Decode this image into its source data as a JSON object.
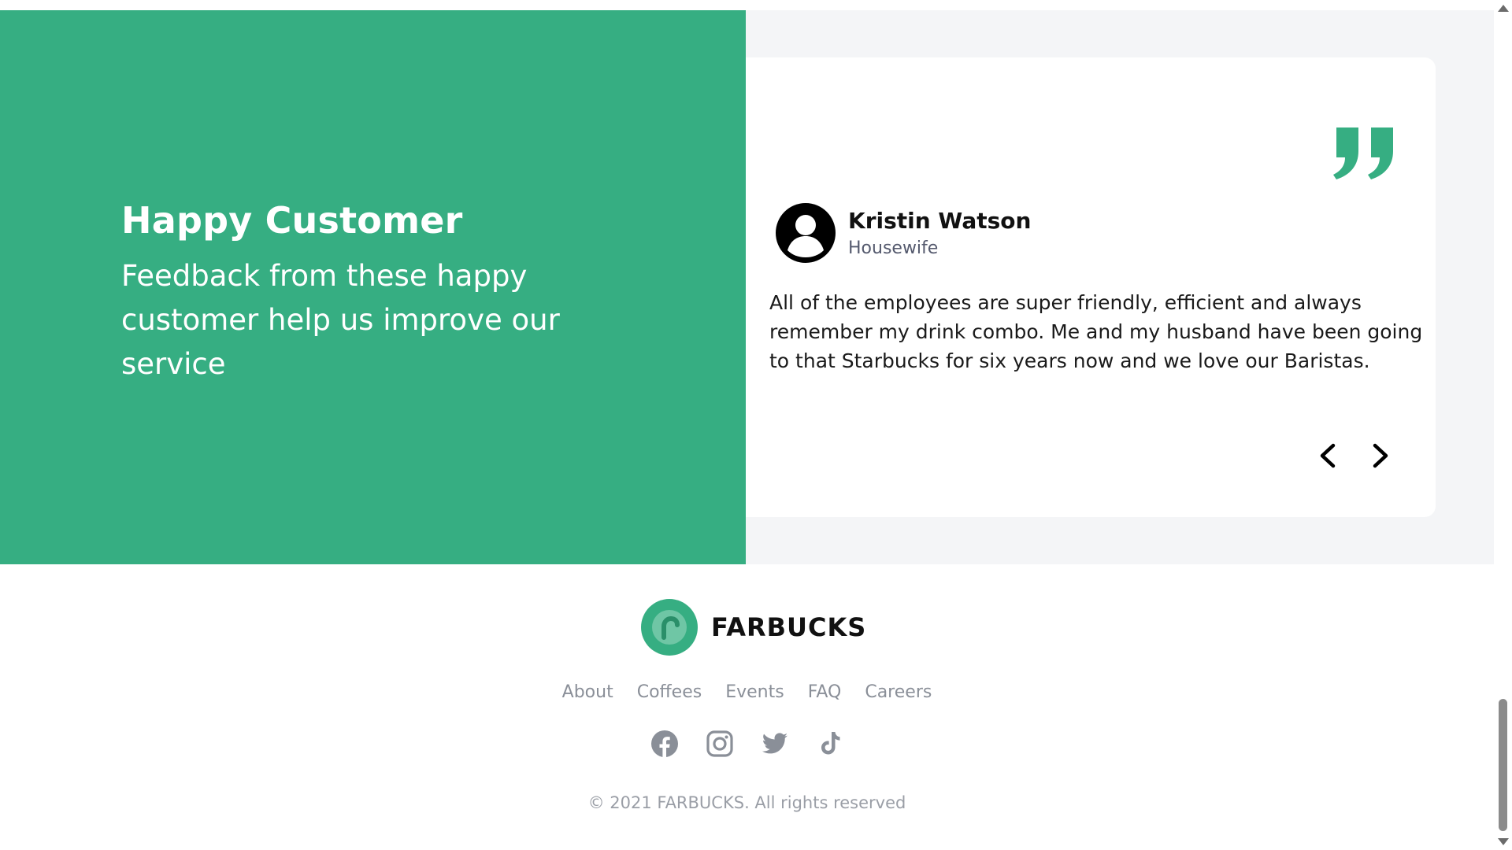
{
  "testimonials": {
    "heading": "Happy Customer",
    "subheading": "Feedback from these happy customer help us improve our service",
    "quote_icon": "closing-quote-icon",
    "review": {
      "name": "Kristin Watson",
      "role": "Housewife",
      "text": "All of the employees are super friendly, efficient and always remember my drink combo. Me and my husband have been going to that Starbucks for six years now and we love our Baristas."
    },
    "prev_icon": "chevron-left-icon",
    "next_icon": "chevron-right-icon"
  },
  "footer": {
    "brand_name": "FARBUCKS",
    "links": [
      "About",
      "Coffees",
      "Events",
      "FAQ",
      "Careers"
    ],
    "social": [
      "facebook-icon",
      "instagram-icon",
      "twitter-icon",
      "tiktok-icon"
    ],
    "copyright": "© 2021 FARBUCKS. All rights reserved"
  },
  "colors": {
    "brand_green": "#36ae82",
    "section_bg": "#f4f5f7",
    "muted_text": "#8a8f98"
  }
}
